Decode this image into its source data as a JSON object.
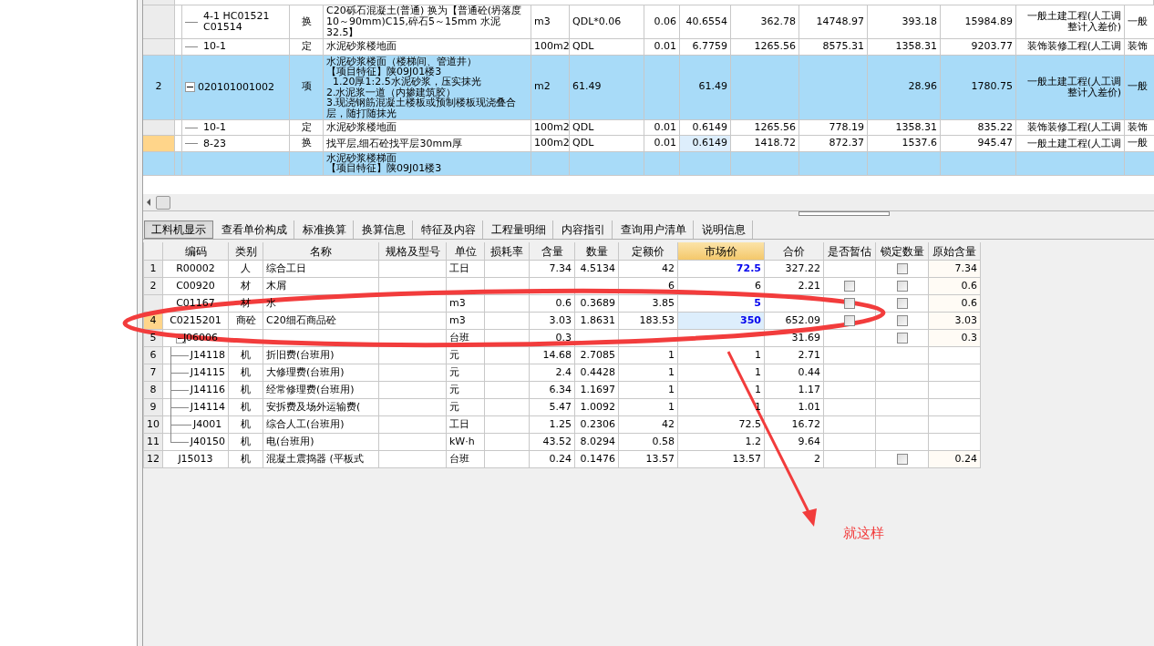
{
  "top_table": {
    "rows": [
      {
        "kind": "continuation",
        "children": [
          {
            "code": "4-1 HC01521 C01514",
            "type": "换",
            "name": "C20砾石混凝土(普通)  换为【普通砼(坍落度10～90mm)C15,碎石5～15mm 水泥32.5】",
            "unit": "m3",
            "expr": "QDL*0.06",
            "values": {
              "column_8": "0.06",
              "column_9": "40.6554",
              "column_10": "362.78",
              "column_11": "14748.97",
              "column_12": "393.18",
              "column_13": "15984.89"
            },
            "category": "一般土建工程(人工调整计入差价)",
            "column_14": "一般",
            "selected": false,
            "highlight_quantity": false
          },
          {
            "code": "10-1",
            "type": "定",
            "name": "水泥砂浆楼地面",
            "unit": "100m2",
            "expr": "QDL",
            "values": {
              "column_8": "0.01",
              "column_9": "6.7759",
              "column_10": "1265.56",
              "column_11": "8575.31",
              "column_12": "1358.31",
              "column_13": "9203.77"
            },
            "category": "装饰装修工程(人工调",
            "column_14": "装饰",
            "selected": false,
            "highlight_quantity": false
          }
        ]
      },
      {
        "kind": "item",
        "number": "2",
        "expanded": true,
        "code": "020101001002",
        "type": "项",
        "name_lines": [
          "水泥砂浆楼面（楼梯间、管道井）",
          "【项目特征】陕09J01楼3",
          "  1.20厚1:2.5水泥砂浆，压实抹光",
          "2.水泥浆一道（内掺建筑胶）",
          "3.现浇钢筋混凝土楼板或预制楼板现浇叠合层，随打随抹光"
        ],
        "unit": "m2",
        "expr": "61.49",
        "values": {
          "column_9": "61.49",
          "column_12": "28.96",
          "column_13": "1780.75"
        },
        "category": "一般土建工程(人工调整计入差价)",
        "column_14": "一般",
        "children": [
          {
            "code": "10-1",
            "type": "定",
            "name": "水泥砂浆楼地面",
            "unit": "100m2",
            "expr": "QDL",
            "values": {
              "column_8": "0.01",
              "column_9": "0.6149",
              "column_10": "1265.56",
              "column_11": "778.19",
              "column_12": "1358.31",
              "column_13": "835.22"
            },
            "category": "装饰装修工程(人工调",
            "column_14": "装饰",
            "selected": false,
            "highlight_quantity": false
          },
          {
            "code": "8-23",
            "type": "换",
            "name": "找平层,细石砼找平层30mm厚",
            "unit": "100m2",
            "expr": "QDL",
            "values": {
              "column_8": "0.01",
              "column_9": "0.6149",
              "column_10": "1418.72",
              "column_11": "872.37",
              "column_12": "1537.6",
              "column_13": "945.47"
            },
            "category": "一般土建工程(人工调",
            "column_14": "一般",
            "selected": true,
            "highlight_quantity": true
          }
        ]
      },
      {
        "kind": "partial",
        "name_lines": [
          "水泥砂浆楼梯面",
          "【项目特征】陕09J01楼3"
        ]
      }
    ]
  },
  "tabs": [
    {
      "label": "工料机显示",
      "selected": true
    },
    {
      "label": "查看单价构成",
      "selected": false
    },
    {
      "label": "标准换算",
      "selected": false
    },
    {
      "label": "换算信息",
      "selected": false
    },
    {
      "label": "特征及内容",
      "selected": false
    },
    {
      "label": "工程量明细",
      "selected": false
    },
    {
      "label": "内容指引",
      "selected": false
    },
    {
      "label": "查询用户清单",
      "selected": false
    },
    {
      "label": "说明信息",
      "selected": false
    }
  ],
  "resource_table": {
    "columns": [
      {
        "label": "编码",
        "selected": false
      },
      {
        "label": "类别",
        "selected": false
      },
      {
        "label": "名称",
        "selected": false
      },
      {
        "label": "规格及型号",
        "selected": false
      },
      {
        "label": "单位",
        "selected": false
      },
      {
        "label": "损耗率",
        "selected": false
      },
      {
        "label": "含量",
        "selected": false
      },
      {
        "label": "数量",
        "selected": false
      },
      {
        "label": "定额价",
        "selected": false
      },
      {
        "label": "市场价",
        "selected": true
      },
      {
        "label": "合价",
        "selected": false
      },
      {
        "label": "是否暂估",
        "selected": false
      },
      {
        "label": "锁定数量",
        "selected": false
      },
      {
        "label": "原始含量",
        "selected": false
      }
    ],
    "rows": [
      {
        "number": "1",
        "code": "R00002",
        "type": "人",
        "name": "综合工日",
        "unit": "工日",
        "content": "7.34",
        "qty": "4.5134",
        "quota_price": "42",
        "market_price": "72.5",
        "adjusted": true,
        "total": "327.22",
        "lock": {
          "checked": false
        },
        "original": "7.34",
        "selected": false
      },
      {
        "number": "2",
        "code": "C00920",
        "type": "材",
        "name": "木屑",
        "quota_price": "6",
        "market_price": "6",
        "adjusted": false,
        "total": "2.21",
        "estimate": {
          "checked": false
        },
        "lock": {
          "checked": false
        },
        "original": "0.6",
        "selected": false
      },
      {
        "code": "C01167",
        "type": "材",
        "name": "水",
        "unit": "m3",
        "content": "0.6",
        "qty": "0.3689",
        "quota_price": "3.85",
        "market_price": "5",
        "adjusted": true,
        "estimate": {
          "checked": false
        },
        "lock": {
          "checked": false
        },
        "original": "0.6",
        "selected": false
      },
      {
        "number": "4",
        "code": "C0215201",
        "type": "商砼",
        "name": "C20细石商品砼",
        "unit": "m3",
        "content": "3.03",
        "qty": "1.8631",
        "quota_price": "183.53",
        "market_price": "350",
        "adjusted": true,
        "total": "652.09",
        "estimate": {
          "checked": false
        },
        "lock": {
          "checked": false
        },
        "original": "3.03",
        "selected": true
      },
      {
        "number": "5",
        "code": "J06006",
        "unit": "台班",
        "content": "0.3",
        "total": "31.69",
        "lock": {
          "checked": false
        },
        "original": "0.3",
        "selected": false,
        "expanded": true,
        "children": [
          {
            "number": "6",
            "code": "J14118",
            "type": "机",
            "name": "折旧费(台班用)",
            "unit": "元",
            "content": "14.68",
            "qty": "2.7085",
            "quota_price": "1",
            "market_price": "1",
            "adjusted": false,
            "total": "2.71",
            "selected": false
          },
          {
            "number": "7",
            "code": "J14115",
            "type": "机",
            "name": "大修理费(台班用)",
            "unit": "元",
            "content": "2.4",
            "qty": "0.4428",
            "quota_price": "1",
            "market_price": "1",
            "adjusted": false,
            "total": "0.44",
            "selected": false
          },
          {
            "number": "8",
            "code": "J14116",
            "type": "机",
            "name": "经常修理费(台班用)",
            "unit": "元",
            "content": "6.34",
            "qty": "1.1697",
            "quota_price": "1",
            "market_price": "1",
            "adjusted": false,
            "total": "1.17",
            "selected": false
          },
          {
            "number": "9",
            "code": "J14114",
            "type": "机",
            "name": "安拆费及场外运输费(",
            "unit": "元",
            "content": "5.47",
            "qty": "1.0092",
            "quota_price": "1",
            "market_price": "1",
            "adjusted": false,
            "total": "1.01",
            "selected": false
          },
          {
            "number": "10",
            "code": "J4001",
            "type": "机",
            "name": "综合人工(台班用)",
            "unit": "工日",
            "content": "1.25",
            "qty": "0.2306",
            "quota_price": "42",
            "market_price": "72.5",
            "adjusted": false,
            "total": "16.72",
            "selected": false
          },
          {
            "number": "11",
            "code": "J40150",
            "type": "机",
            "name": "电(台班用)",
            "unit": "kW·h",
            "content": "43.52",
            "qty": "8.0294",
            "quota_price": "0.58",
            "market_price": "1.2",
            "adjusted": false,
            "total": "9.64",
            "selected": false
          }
        ]
      },
      {
        "number": "12",
        "code": "J15013",
        "type": "机",
        "name": "混凝土震捣器 (平板式",
        "unit": "台班",
        "content": "0.24",
        "qty": "0.1476",
        "quota_price": "13.57",
        "market_price": "13.57",
        "adjusted": false,
        "total": "2",
        "lock": {
          "checked": false
        },
        "original": "0.24",
        "selected": false
      }
    ]
  },
  "annotation": {
    "text": "就这样"
  }
}
